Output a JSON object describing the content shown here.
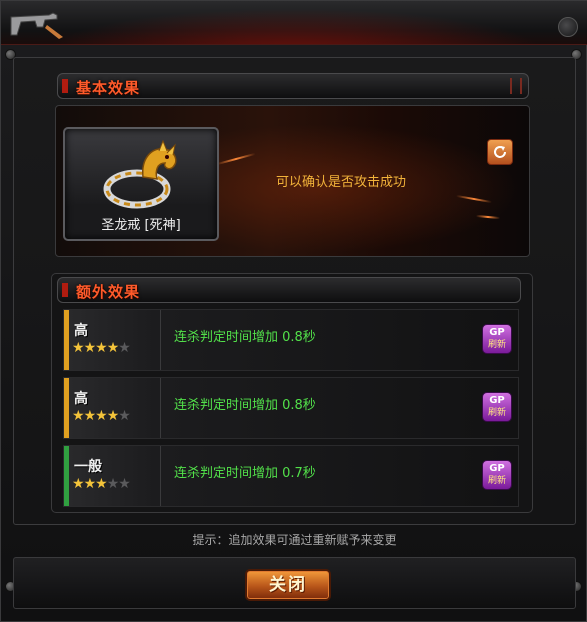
{
  "window": {
    "gun_icon": "gun-icon",
    "close_icon": "close-icon"
  },
  "basic": {
    "header": "基本效果",
    "item_name": "圣龙戒 [死神]",
    "item_icon": "dragon-ring-icon",
    "effect": "可以确认是否攻击成功",
    "refresh_icon": "refresh-icon"
  },
  "extra": {
    "header": "额外效果",
    "rows": [
      {
        "grade": "高",
        "stars": 4,
        "max_stars": 5,
        "effect": "连杀判定时间增加 0.8秒",
        "accent": "#e0a020",
        "button_top": "GP",
        "button_bottom": "刷新"
      },
      {
        "grade": "高",
        "stars": 4,
        "max_stars": 5,
        "effect": "连杀判定时间增加 0.8秒",
        "accent": "#e0a020",
        "button_top": "GP",
        "button_bottom": "刷新"
      },
      {
        "grade": "一般",
        "stars": 3,
        "max_stars": 5,
        "effect": "连杀判定时间增加 0.7秒",
        "accent": "#30a040",
        "button_top": "GP",
        "button_bottom": "刷新"
      }
    ]
  },
  "hint": "提示：追加效果可通过重新赋予来变更",
  "footer": {
    "close_label": "关闭"
  },
  "colors": {
    "header_text": "#ff5a2a",
    "effect_green": "#52e04a",
    "basic_effect": "#f2b33a"
  }
}
